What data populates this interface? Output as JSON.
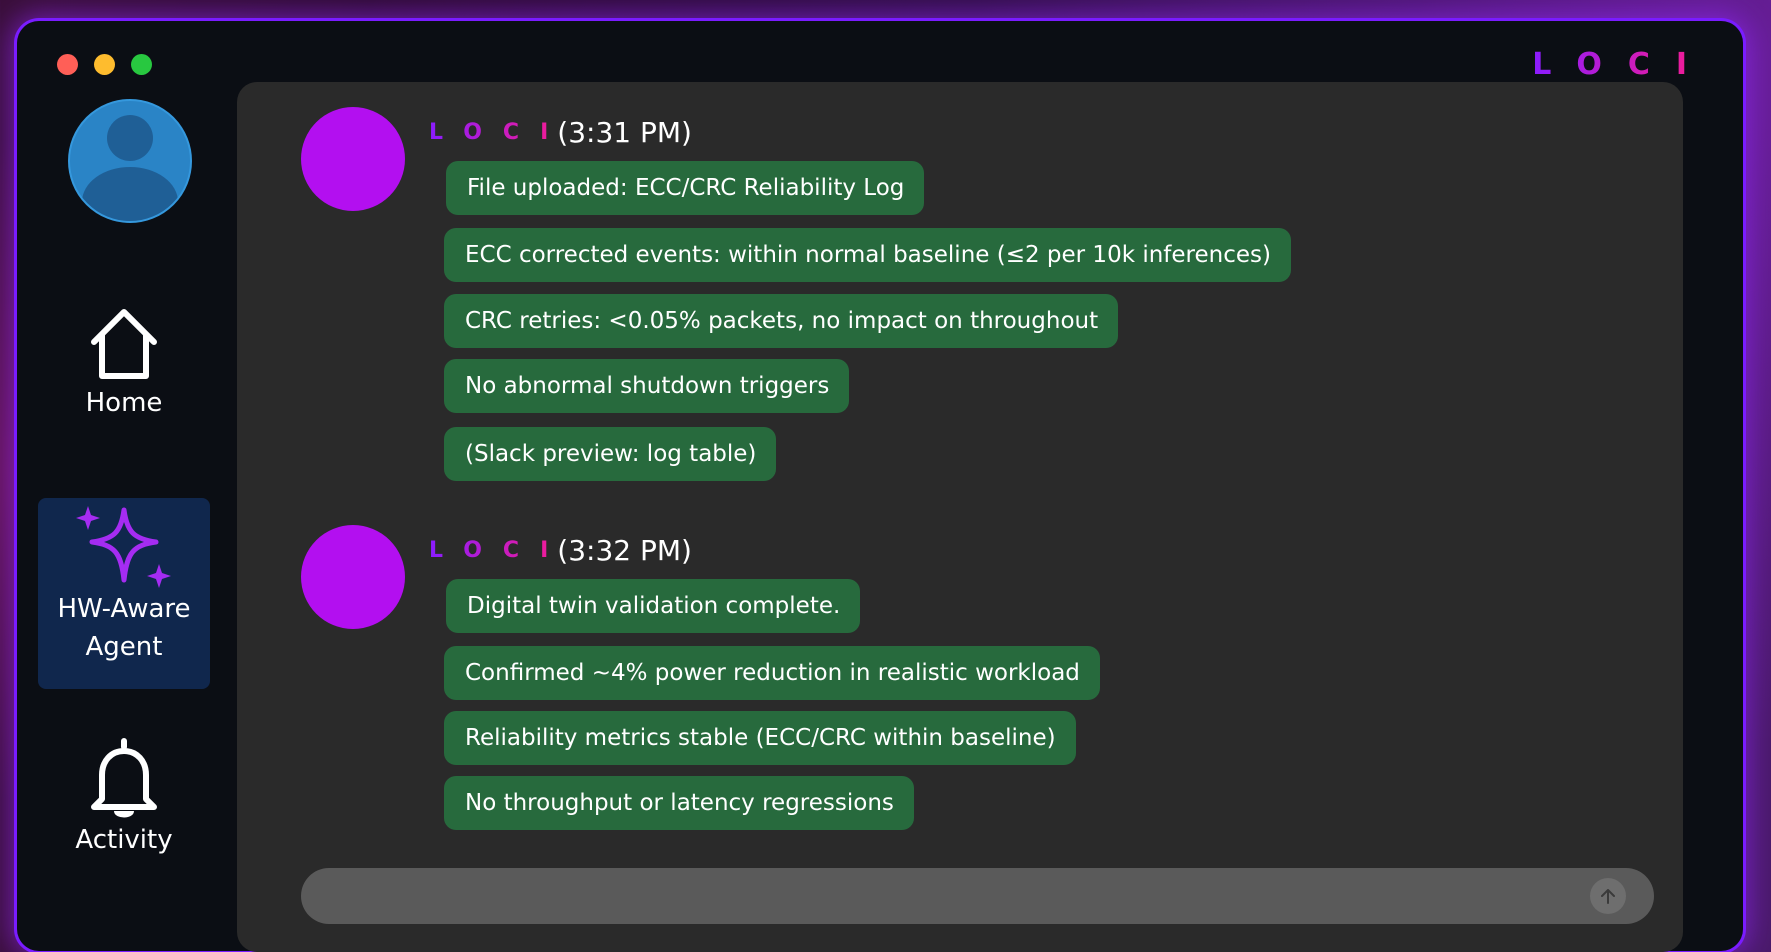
{
  "window": {
    "title_brand": "LOCI"
  },
  "sidebar": {
    "items": [
      {
        "label": "Home",
        "icon": "home-icon"
      },
      {
        "label": "HW-Aware Agent",
        "icon": "sparkle-icon",
        "active": true
      },
      {
        "label": "Activity",
        "icon": "bell-icon"
      }
    ]
  },
  "colors": {
    "accent_purple": "#a316ff",
    "bubble_green": "#276a3d",
    "avatar_magenta": "#b30ff0",
    "active_nav": "#10274d"
  },
  "messages": [
    {
      "sender": "LOCI",
      "time": "(3:31 PM)",
      "bubbles": [
        "File uploaded: ECC/CRC Reliability Log",
        "ECC corrected events: within normal baseline (≤2 per 10k inferences)",
        "CRC retries: <0.05% packets, no impact on throughout",
        "No abnormal shutdown triggers",
        "(Slack preview: log table)"
      ]
    },
    {
      "sender": "LOCI",
      "time": "(3:32 PM)",
      "bubbles": [
        "Digital twin validation complete.",
        "Confirmed ~4% power reduction in realistic workload",
        "Reliability metrics stable (ECC/CRC within baseline)",
        "No throughput or latency regressions"
      ]
    }
  ],
  "composer": {
    "placeholder": "",
    "send_icon": "arrow-up-icon"
  }
}
